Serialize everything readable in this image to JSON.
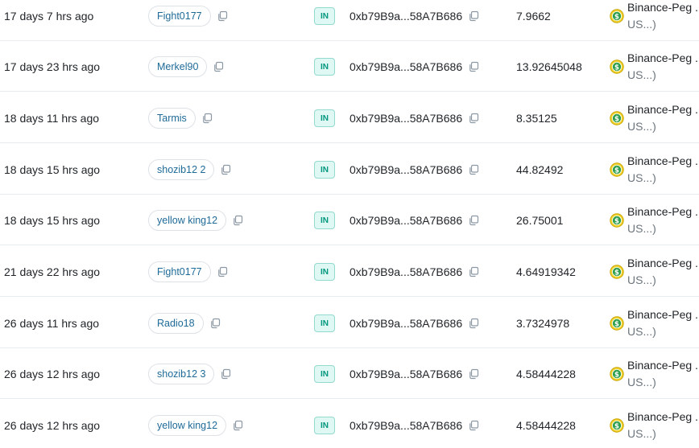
{
  "rows": [
    {
      "age": "17 days 7 hrs ago",
      "from": "Fight0177",
      "direction": "IN",
      "to": "0xb79B9a...58A7B686",
      "value": "7.9662",
      "token_name": "Binance-Peg .",
      "token_symbol": "US...)"
    },
    {
      "age": "17 days 23 hrs ago",
      "from": "Merkel90",
      "direction": "IN",
      "to": "0xb79B9a...58A7B686",
      "value": "13.92645048",
      "token_name": "Binance-Peg .",
      "token_symbol": "US...)"
    },
    {
      "age": "18 days 11 hrs ago",
      "from": "Tarmis",
      "direction": "IN",
      "to": "0xb79B9a...58A7B686",
      "value": "8.35125",
      "token_name": "Binance-Peg .",
      "token_symbol": "US...)"
    },
    {
      "age": "18 days 15 hrs ago",
      "from": "shozib12 2",
      "direction": "IN",
      "to": "0xb79B9a...58A7B686",
      "value": "44.82492",
      "token_name": "Binance-Peg .",
      "token_symbol": "US...)"
    },
    {
      "age": "18 days 15 hrs ago",
      "from": "yellow king12",
      "direction": "IN",
      "to": "0xb79B9a...58A7B686",
      "value": "26.75001",
      "token_name": "Binance-Peg .",
      "token_symbol": "US...)"
    },
    {
      "age": "21 days 22 hrs ago",
      "from": "Fight0177",
      "direction": "IN",
      "to": "0xb79B9a...58A7B686",
      "value": "4.64919342",
      "token_name": "Binance-Peg .",
      "token_symbol": "US...)"
    },
    {
      "age": "26 days 11 hrs ago",
      "from": "Radio18",
      "direction": "IN",
      "to": "0xb79B9a...58A7B686",
      "value": "3.7324978",
      "token_name": "Binance-Peg .",
      "token_symbol": "US...)"
    },
    {
      "age": "26 days 12 hrs ago",
      "from": "shozib12 3",
      "direction": "IN",
      "to": "0xb79B9a...58A7B686",
      "value": "4.58444228",
      "token_name": "Binance-Peg .",
      "token_symbol": "US...)"
    },
    {
      "age": "26 days 12 hrs ago",
      "from": "yellow king12",
      "direction": "IN",
      "to": "0xb79B9a...58A7B686",
      "value": "4.58444228",
      "token_name": "Binance-Peg .",
      "token_symbol": "US...)"
    }
  ],
  "icons": {
    "copy": "copy-icon",
    "token": "usd-coin-icon"
  },
  "colors": {
    "link": "#1e6a97",
    "in_badge_text": "#02977e",
    "in_badge_bg": "#e0f8f4",
    "token_icon_ring": "#c8a400",
    "token_icon_fill": "#2e9e4f",
    "row_divider": "#e9ecef"
  }
}
